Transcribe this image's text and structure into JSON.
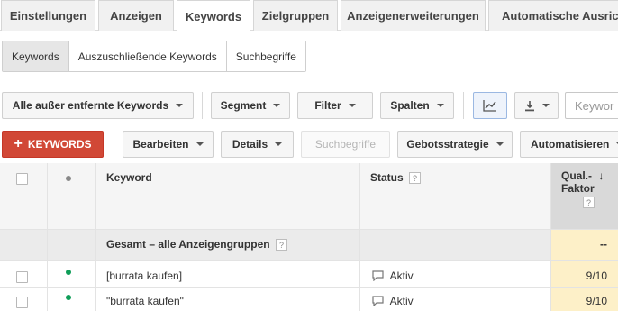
{
  "tabs": [
    "Einstellungen",
    "Anzeigen",
    "Keywords",
    "Zielgruppen",
    "Anzeigenerweiterungen",
    "Automatische Ausricht"
  ],
  "subtabs": [
    "Keywords",
    "Auszuschließende Keywords",
    "Suchbegriffe"
  ],
  "toolbar1": {
    "filter_view": "Alle außer entfernte Keywords",
    "segment": "Segment",
    "filter": "Filter",
    "columns": "Spalten",
    "search_placeholder": "Keywor"
  },
  "toolbar2": {
    "add": "KEYWORDS",
    "edit": "Bearbeiten",
    "details": "Details",
    "search_terms": "Suchbegriffe",
    "bid_strategy": "Gebotsstrategie",
    "automate": "Automatisieren"
  },
  "table": {
    "headers": {
      "keyword": "Keyword",
      "status": "Status",
      "quality_line1": "Qual.-",
      "quality_line2": "Faktor"
    },
    "summary": {
      "label": "Gesamt – alle Anzeigengruppen",
      "quality": "--"
    },
    "rows": [
      {
        "keyword": "[burrata kaufen]",
        "status": "Aktiv",
        "quality": "9/10",
        "status_color": "#0f9d58"
      },
      {
        "keyword": "\"burrata kaufen\"",
        "status": "Aktiv",
        "quality": "9/10",
        "status_color": "#0f9d58"
      }
    ]
  },
  "icons": {
    "help": "?",
    "sort": "↓",
    "plus": "+"
  }
}
